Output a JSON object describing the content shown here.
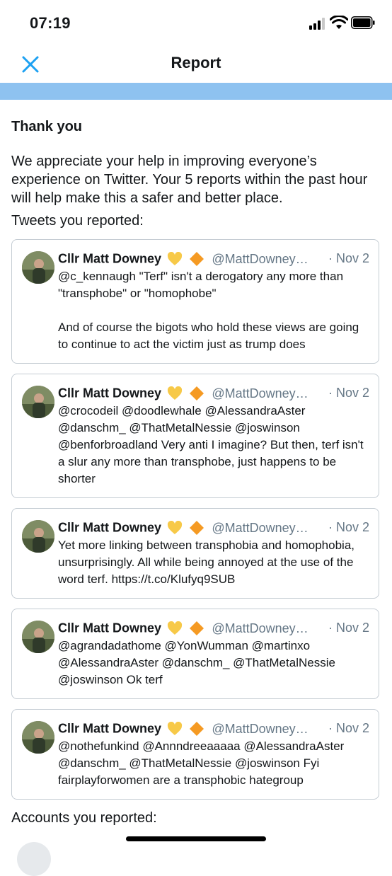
{
  "status_bar": {
    "time": "07:19"
  },
  "nav": {
    "title": "Report",
    "close_icon": "close-icon"
  },
  "colors": {
    "accent": "#1da1f2",
    "band": "#8ec2f0",
    "secondary_text": "#657786",
    "border": "#c4ccd3"
  },
  "thank_you": {
    "heading": "Thank you",
    "body": "We appreciate your help in improving everyone’s experience on Twitter. Your 5 reports within the past hour will help make this a safer and better place."
  },
  "tweets_label": "Tweets you reported:",
  "tweets": [
    {
      "name": "Cllr Matt Downey",
      "handle": "@MattDowney…",
      "date": "· Nov 2",
      "text": "@c_kennaugh \"Terf\" isn't a derogatory any more than \"transphobe\" or \"homophobe\"\n\nAnd of course the bigots who hold these views are going to continue to act the victim just as trump does"
    },
    {
      "name": "Cllr Matt Downey",
      "handle": "@MattDowney…",
      "date": "· Nov 2",
      "text": "@crocodeil @doodlewhale @AlessandraAster @danschm_ @ThatMetalNessie @joswinson @benforbroadland Very anti I imagine? But then, terf isn't a slur any more than transphobe, just happens to be shorter"
    },
    {
      "name": "Cllr Matt Downey",
      "handle": "@MattDowney…",
      "date": "· Nov 2",
      "text": "Yet more linking between transphobia and homophobia, unsurprisingly. All while being annoyed at the use of the word terf. https://t.co/Klufyq9SUB"
    },
    {
      "name": "Cllr Matt Downey",
      "handle": "@MattDowney…",
      "date": "· Nov 2",
      "text": "@agrandadathome @YonWumman @martinxo @AlessandraAster @danschm_ @ThatMetalNessie @joswinson Ok terf"
    },
    {
      "name": "Cllr Matt Downey",
      "handle": "@MattDowney…",
      "date": "· Nov 2",
      "text": "@nothefunkind @Annndreeaaaaa @AlessandraAster @danschm_ @ThatMetalNessie @joswinson Fyi fairplayforwomen are a transphobic hategroup"
    }
  ],
  "accounts_label": "Accounts you reported:"
}
